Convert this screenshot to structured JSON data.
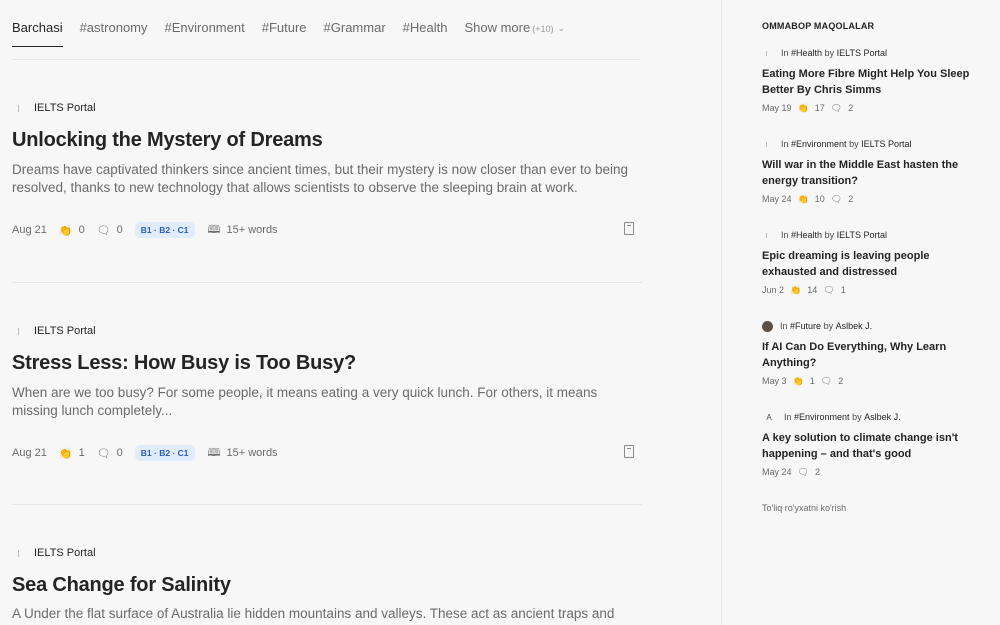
{
  "tabs": [
    {
      "label": "Barchasi"
    },
    {
      "label": "#astronomy"
    },
    {
      "label": "#Environment"
    },
    {
      "label": "#Future"
    },
    {
      "label": "#Grammar"
    },
    {
      "label": "#Health"
    }
  ],
  "show_more": {
    "label": "Show more",
    "count": "(+10)"
  },
  "articles": [
    {
      "author": "IELTS Portal",
      "title": "Unlocking the Mystery of Dreams",
      "excerpt": "Dreams have captivated thinkers since ancient times, but their mystery is now closer than ever to being resolved, thanks to new technology that allows scientists to observe the sleeping brain at work.",
      "date": "Aug 21",
      "claps": "0",
      "comments": "0",
      "levels": "B1 · B2 · C1",
      "words": "15+ words"
    },
    {
      "author": "IELTS Portal",
      "title": "Stress Less: How Busy is Too Busy?",
      "excerpt": "When are we too busy? For some people, it means eating a very quick lunch. For others, it means missing lunch completely...",
      "date": "Aug 21",
      "claps": "1",
      "comments": "0",
      "levels": "B1 · B2 · C1",
      "words": "15+ words"
    },
    {
      "author": "IELTS Portal",
      "title": "Sea Change for Salinity",
      "excerpt": "A Under the flat surface of Australia lie hidden mountains and valleys. These act as ancient traps and"
    }
  ],
  "sidebar": {
    "title": "OMMABOP MAQOLALAR",
    "in_word": "In",
    "by_word": "by",
    "picks": [
      {
        "tag": "#Health",
        "author": "IELTS Portal",
        "title": "Eating More Fibre Might Help You Sleep Better By Chris Simms",
        "date": "May 19",
        "claps": "17",
        "comments": "2",
        "mark": "line"
      },
      {
        "tag": "#Environment",
        "author": "IELTS Portal",
        "title": "Will war in the Middle East hasten the energy transition?",
        "date": "May 24",
        "claps": "10",
        "comments": "2",
        "mark": "line"
      },
      {
        "tag": "#Health",
        "author": "IELTS Portal",
        "title": "Epic dreaming is leaving people exhausted and distressed",
        "date": "Jun 2",
        "claps": "14",
        "comments": "1",
        "mark": "line"
      },
      {
        "tag": "#Future",
        "author": "Aslbek J.",
        "title": "If AI Can Do Everything, Why Learn Anything?",
        "date": "May 3",
        "claps": "1",
        "comments": "2",
        "mark": "avatar"
      },
      {
        "tag": "#Environment",
        "author": "Aslbek J.",
        "title": "A key solution to climate change isn't happening – and that's good",
        "date": "May 24",
        "claps": null,
        "comments": "2",
        "mark": "letter",
        "mark_text": "A"
      }
    ],
    "see_all": "To'liq ro'yxatni ko'rish"
  },
  "icons": {
    "clap": "clap-icon",
    "comment": "comment-icon",
    "book": "book-icon",
    "bookmark": "bookmark-icon",
    "chevron": "chevron-down-icon"
  },
  "colors": {
    "background": "#f7f7f7",
    "badge_bg": "#e1ecfb",
    "badge_text": "#2a5fb8",
    "text": "#242424",
    "muted": "#6b6b6b"
  }
}
